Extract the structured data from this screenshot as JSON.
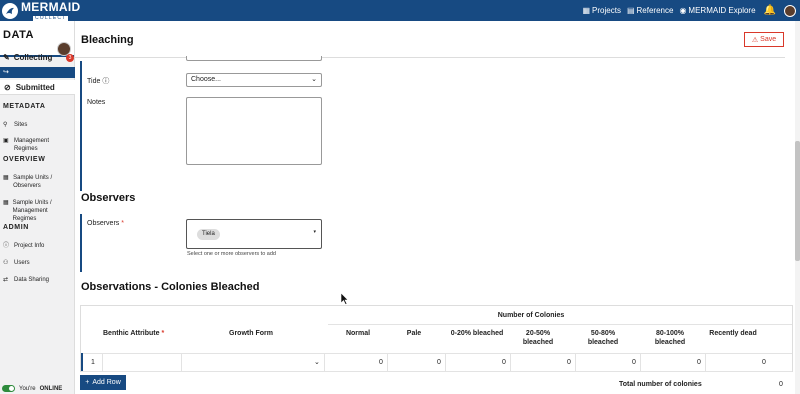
{
  "topbar": {
    "logo_title": "MERMAID",
    "logo_sub": "COLLECT",
    "nav": [
      {
        "label": "Projects",
        "icon": "projects-icon"
      },
      {
        "label": "Reference",
        "icon": "reference-icon"
      },
      {
        "label": "MERMAID Explore",
        "icon": "globe-icon"
      }
    ]
  },
  "sidebar": {
    "title": "DATA",
    "collecting": "Collecting",
    "badge": "3",
    "submitted": "Submitted",
    "sections": {
      "metadata": "METADATA",
      "overview": "OVERVIEW",
      "admin": "ADMIN"
    },
    "metadata_items": [
      "Sites",
      "Management Regimes"
    ],
    "overview_items": [
      "Sample Units / Observers",
      "Sample Units / Management Regimes"
    ],
    "admin_items": [
      "Project Info",
      "Users",
      "Data Sharing"
    ],
    "online_prefix": "You're",
    "online_status": "ONLINE"
  },
  "header": {
    "title": "Bleaching",
    "save_label": "Save"
  },
  "form": {
    "tide_label": "Tide",
    "tide_value": "Choose...",
    "notes_label": "Notes"
  },
  "observers": {
    "section_title": "Observers",
    "field_label": "Observers",
    "required_mark": "*",
    "chip": "Tiela",
    "helper": "Select one or more observers to add"
  },
  "observations": {
    "section_title": "Observations - Colonies Bleached",
    "group_header": "Number of Colonies",
    "columns": {
      "benthic": "Benthic Attribute",
      "growth": "Growth Form",
      "normal": "Normal",
      "pale": "Pale",
      "b0_20": "0-20% bleached",
      "b20_50": "20-50% bleached",
      "b50_80": "50-80% bleached",
      "b80_100": "80-100% bleached",
      "dead": "Recently dead"
    },
    "row": {
      "index": "1",
      "values": [
        "0",
        "0",
        "0",
        "0",
        "0",
        "0",
        "0"
      ]
    },
    "add_row_label": "Add Row",
    "total_label": "Total number of colonies",
    "total_value": "0"
  }
}
